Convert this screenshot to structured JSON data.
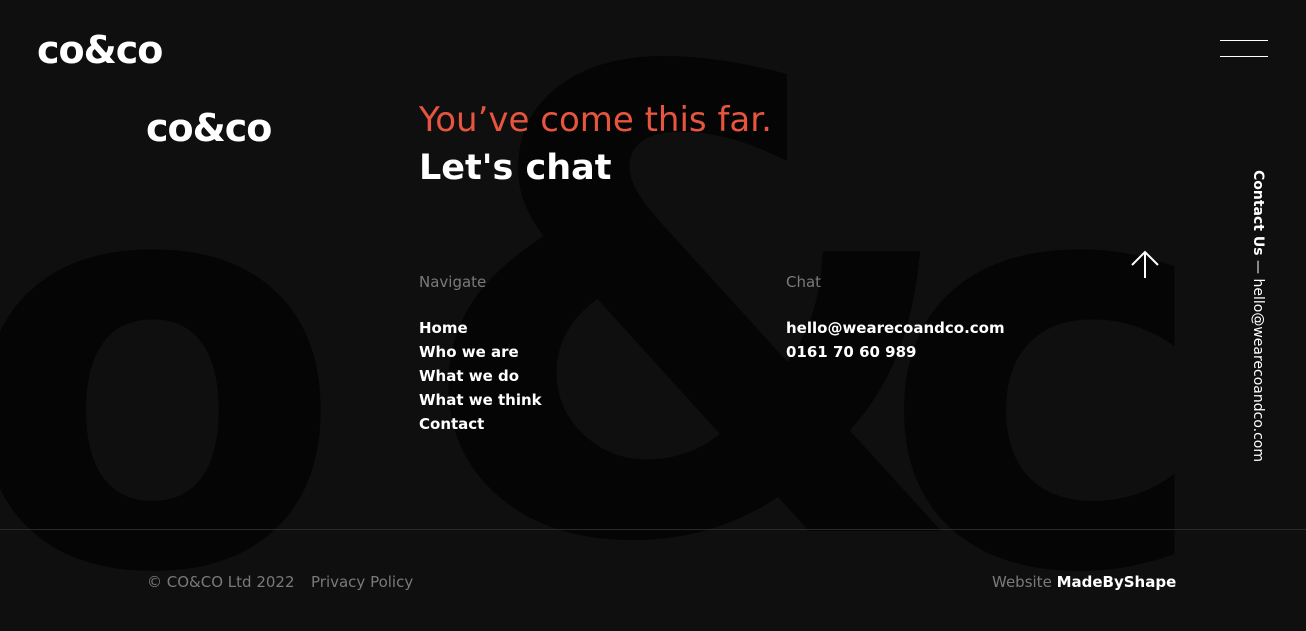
{
  "brand": {
    "logo_top": "co&co",
    "logo_footer": "co&co"
  },
  "background": {
    "glyph_o": "o",
    "glyph_amp": "&",
    "glyph_c": "c"
  },
  "menu": {
    "icon": "hamburger-icon"
  },
  "hero": {
    "headline": "You’ve come this far.",
    "subheadline": "Let's chat",
    "headline_color": "#e8553e"
  },
  "navigate": {
    "title": "Navigate",
    "items": [
      {
        "label": "Home"
      },
      {
        "label": "Who we are"
      },
      {
        "label": "What we do"
      },
      {
        "label": "What we think"
      },
      {
        "label": "Contact"
      }
    ]
  },
  "chat": {
    "title": "Chat",
    "email": "hello@wearecoandco.com",
    "phone": "0161 70 60 989"
  },
  "scroll_top": {
    "icon": "arrow-up-icon"
  },
  "side_contact": {
    "label": "Contact Us",
    "separator": "—",
    "email": "hello@wearecoandco.com"
  },
  "footer": {
    "copyright": "© CO&CO Ltd 2022",
    "privacy": "Privacy Policy",
    "credit_prefix": "Website",
    "credit_maker": "MadeByShape"
  }
}
